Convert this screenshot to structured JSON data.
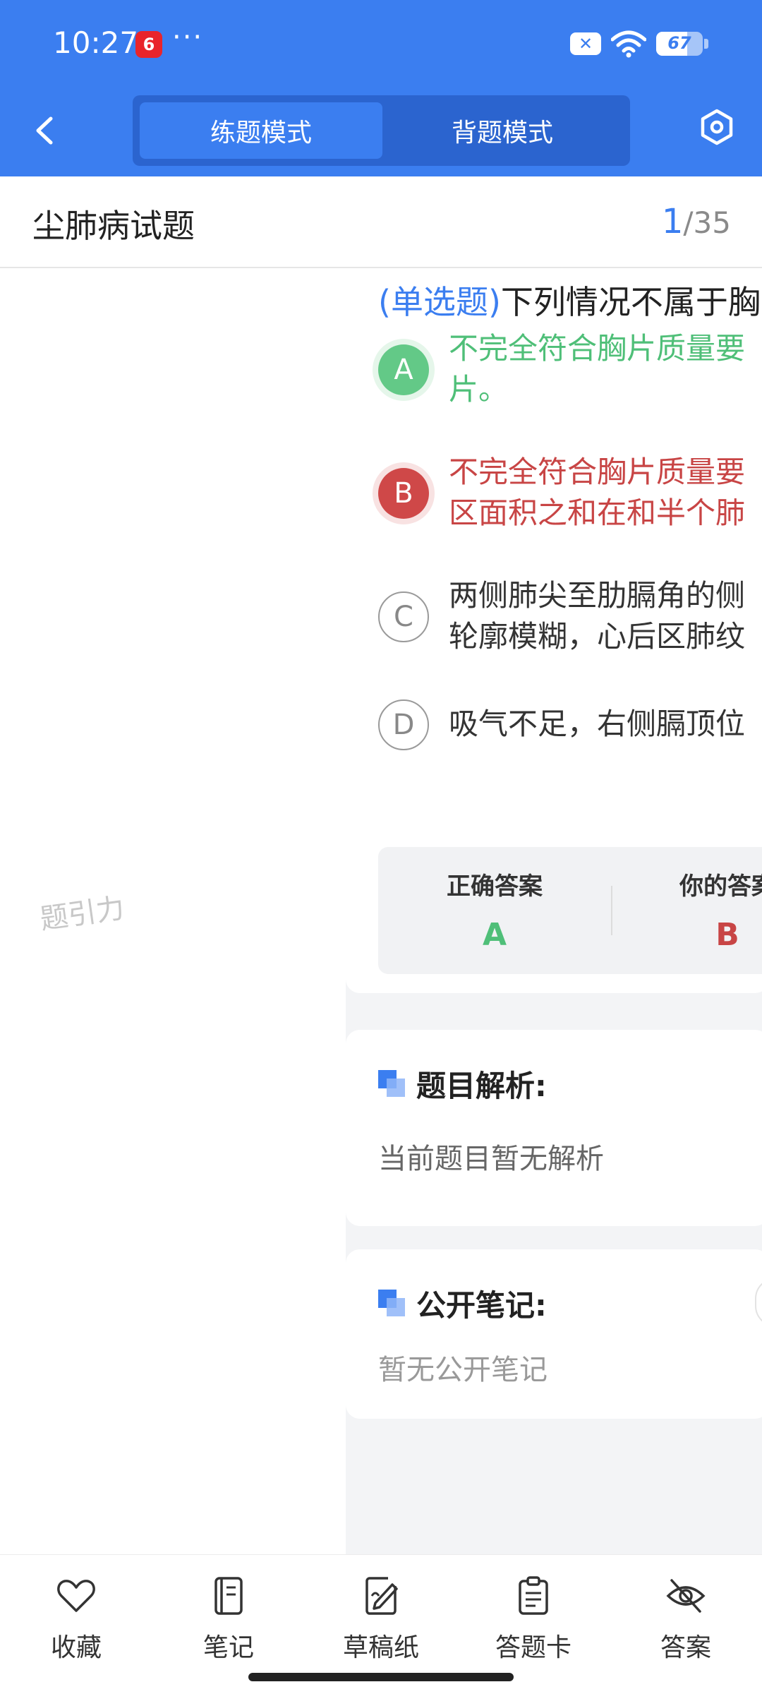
{
  "status_bar": {
    "time": "10:27",
    "app_badge": "6",
    "dots": "···",
    "close_badge": "✕",
    "battery": "67",
    "battery_level": 0.67
  },
  "nav": {
    "modes": [
      "练题模式",
      "背题模式"
    ],
    "active_mode": "练题模式"
  },
  "title_bar": {
    "title": "尘肺病试题",
    "current": "1",
    "separator": "/",
    "total": "35"
  },
  "question": {
    "type_label": "(单选题)",
    "stem": "下列情况不属于胸",
    "options": [
      {
        "letter": "A",
        "text_line1": "不完全符合胸片质量要",
        "text_line2": "片。",
        "state": "correct"
      },
      {
        "letter": "B",
        "text_line1": "不完全符合胸片质量要",
        "text_line2": "区面积之和在和半个肺",
        "state": "wrong"
      },
      {
        "letter": "C",
        "text_line1": "两侧肺尖至肋膈角的侧",
        "text_line2": "轮廓模糊，心后区肺纹",
        "state": "normal"
      },
      {
        "letter": "D",
        "text_line1": "吸气不足，右侧膈顶位",
        "text_line2": "",
        "state": "normal"
      }
    ]
  },
  "answer_box": {
    "correct_label": "正确答案",
    "correct_value": "A",
    "mine_label": "你的答案",
    "mine_value": "B"
  },
  "analysis": {
    "title": "题目解析:",
    "body": "当前题目暂无解析"
  },
  "notes": {
    "title": "公开笔记:",
    "body": "暂无公开笔记"
  },
  "watermark": "题引力",
  "toolbar": [
    {
      "label": "收藏",
      "icon": "heart-icon"
    },
    {
      "label": "笔记",
      "icon": "notebook-icon"
    },
    {
      "label": "草稿纸",
      "icon": "draft-paper-icon"
    },
    {
      "label": "答题卡",
      "icon": "answer-sheet-icon"
    },
    {
      "label": "答案",
      "icon": "eye-off-icon"
    }
  ],
  "colors": {
    "primary": "#3b7ef0",
    "correct": "#4fbf78",
    "wrong": "#c84545"
  }
}
